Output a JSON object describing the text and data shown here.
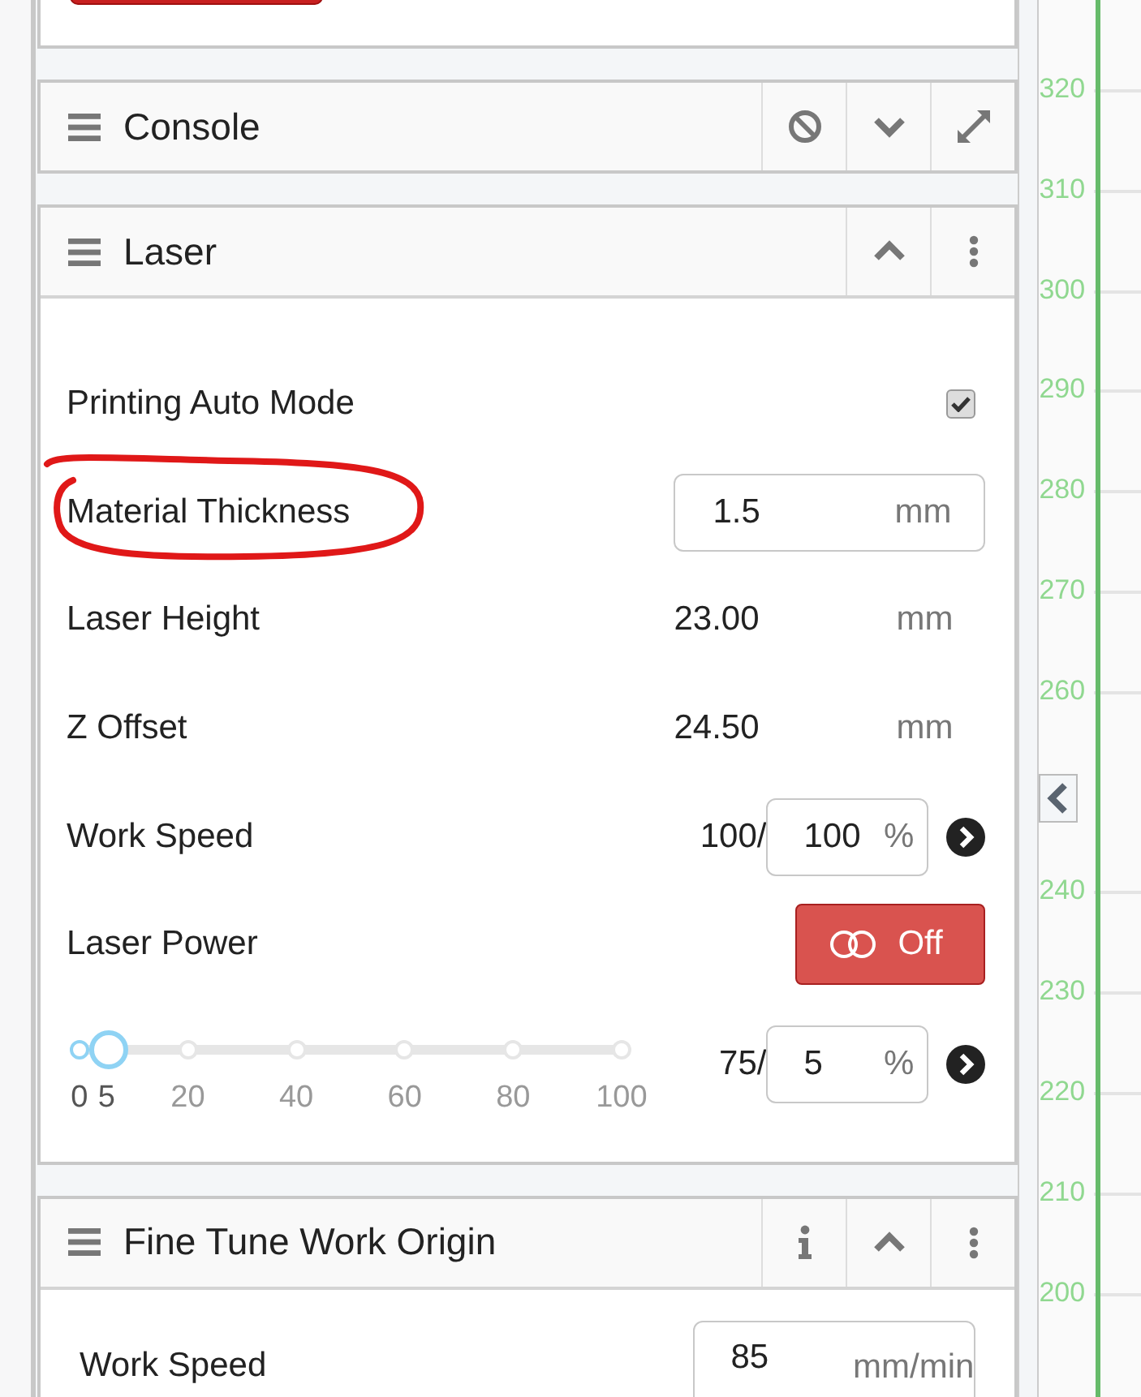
{
  "panels": [
    {
      "title": "Console",
      "tools": [
        {
          "kind": "ban"
        },
        {
          "kind": "chevron_down"
        },
        {
          "kind": "expand"
        }
      ]
    },
    {
      "title": "Laser",
      "tools": [
        {
          "kind": "chevron_up"
        },
        {
          "kind": "more"
        }
      ],
      "rows": [
        {
          "kind": "checkbox",
          "label": "Printing Auto Mode",
          "checked": true
        },
        {
          "kind": "input",
          "label": "Material Thickness",
          "value": "1.5",
          "unit": "mm",
          "circled": true
        },
        {
          "kind": "readout",
          "label": "Laser Height",
          "value": "23.00",
          "unit": "mm"
        },
        {
          "kind": "readout",
          "label": "Z Offset",
          "value": "24.50",
          "unit": "mm"
        },
        {
          "kind": "override",
          "label": "Work Speed",
          "current": "100/",
          "value": "100",
          "unit": "%"
        },
        {
          "kind": "toggle",
          "label": "Laser Power",
          "on": false,
          "text": "Off"
        },
        {
          "kind": "slider",
          "level": 0.05,
          "ticks": [
            "0",
            "20",
            "40",
            "60",
            "80",
            "100"
          ],
          "thumb_label": "5",
          "current": "75/",
          "value": "5",
          "unit": "%"
        }
      ]
    },
    {
      "title": "Fine Tune Work Origin",
      "tools": [
        {
          "kind": "info"
        },
        {
          "kind": "chevron_up"
        },
        {
          "kind": "more"
        }
      ],
      "rows": [
        {
          "kind": "input",
          "label": "Work Speed",
          "value": "85",
          "unit": "mm/min"
        }
      ]
    }
  ],
  "ruler": {
    "labels": [
      "320",
      "310",
      "300",
      "290",
      "280",
      "270",
      "260",
      "240",
      "230",
      "220",
      "210",
      "200"
    ]
  }
}
